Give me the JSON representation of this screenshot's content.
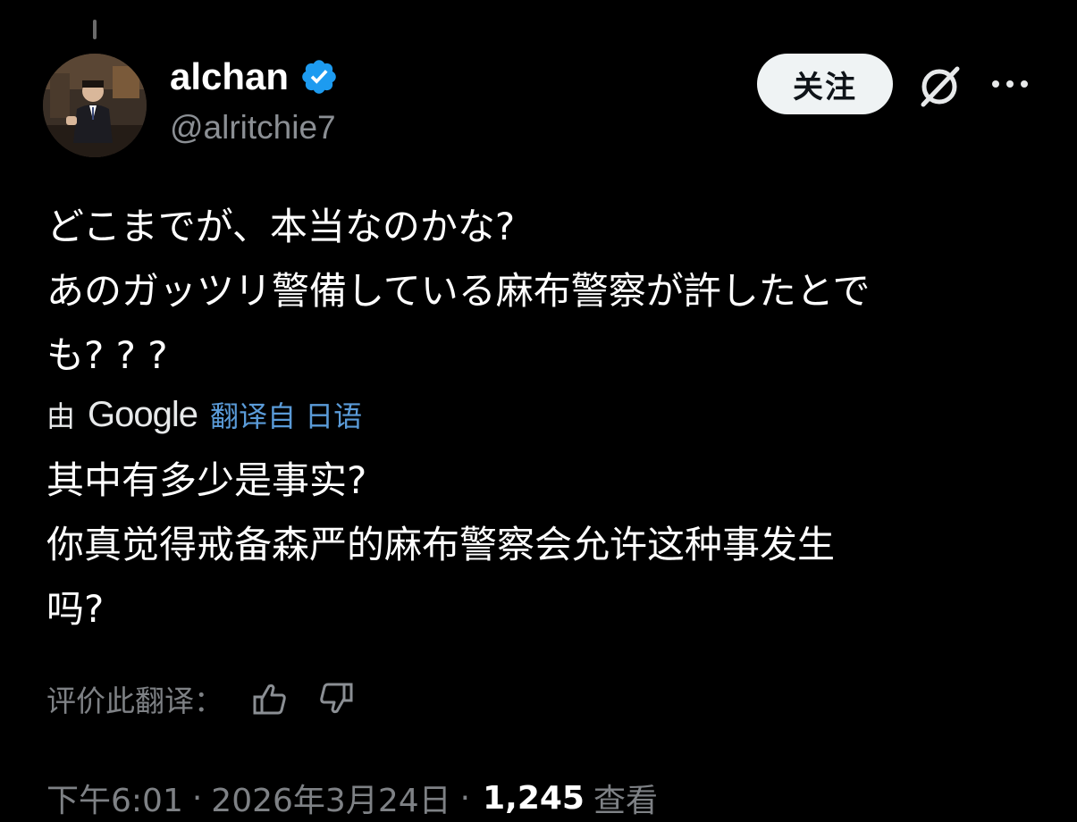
{
  "user": {
    "display_name": "alchan",
    "handle": "@alritchie7",
    "verified_icon": "verified-badge-icon",
    "avatar": "avatar-photo"
  },
  "actions": {
    "follow_label": "关注",
    "grok_icon": "grok-icon",
    "more_icon": "more-horizontal-icon"
  },
  "post": {
    "lines": [
      "どこまでが、本当なのかな?",
      "あのガッツリ警備している麻布警察が許したとで",
      "も? ? ?"
    ]
  },
  "translation": {
    "prefix": "由",
    "provider": "Google",
    "link_label": "翻译自 日语",
    "lines": [
      "其中有多少是事实?",
      "你真觉得戒备森严的麻布警察会允许这种事发生",
      "吗?"
    ]
  },
  "rating": {
    "label": "评价此翻译：",
    "thumbs_up_icon": "thumbs-up-icon",
    "thumbs_down_icon": "thumbs-down-icon"
  },
  "meta": {
    "time": "下午6:01",
    "date": "2026年3月24日",
    "separator": "·",
    "view_count": "1,245",
    "view_label": "查看"
  },
  "colors": {
    "background": "#000000",
    "link": "#5a9bd8",
    "verified": "#1d9bf0",
    "muted": "#7e8185"
  }
}
